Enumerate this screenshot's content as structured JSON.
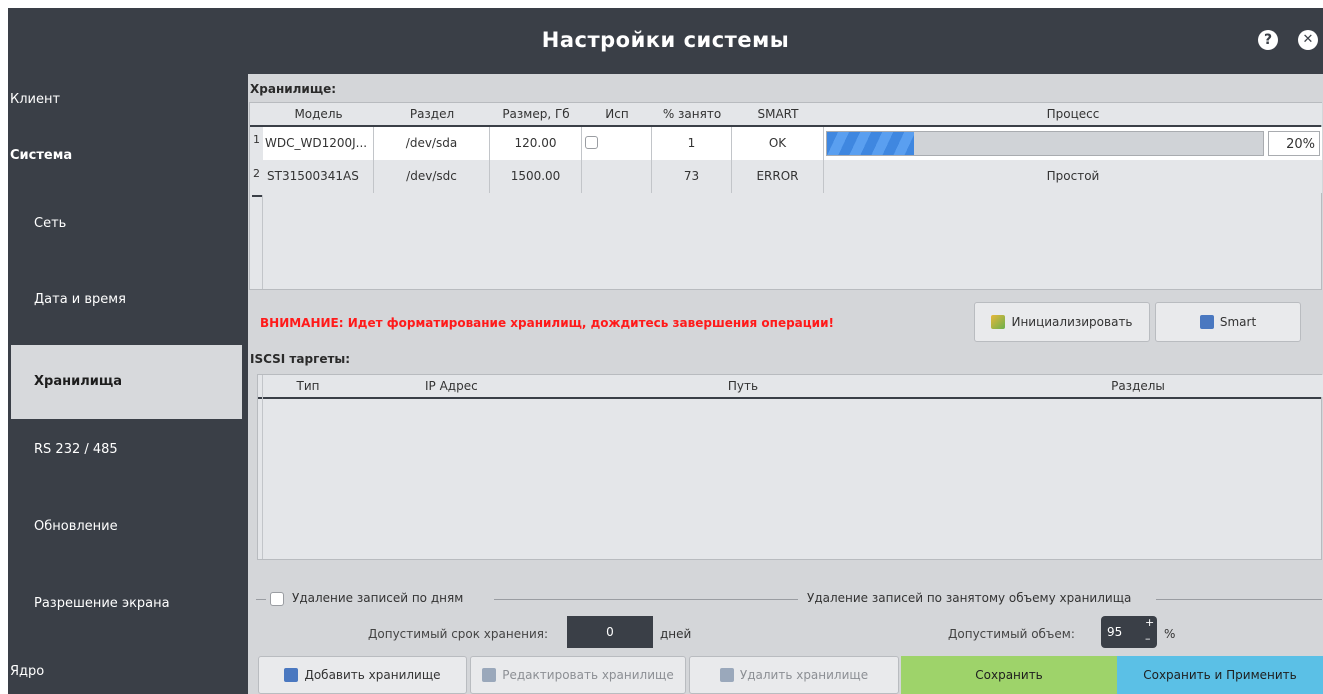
{
  "window": {
    "title": "Настройки системы"
  },
  "titlebar": {
    "help_icon": "?",
    "close_icon": "✕"
  },
  "sidebar": {
    "items": [
      {
        "label": "Клиент"
      },
      {
        "label": "Система"
      },
      {
        "label": "Сеть"
      },
      {
        "label": "Дата и время"
      },
      {
        "label": "Хранилища"
      },
      {
        "label": "RS 232 / 485"
      },
      {
        "label": "Обновление"
      },
      {
        "label": "Разрешение экрана"
      },
      {
        "label": "Ядро"
      }
    ]
  },
  "storage": {
    "label": "Хранилище:",
    "columns": [
      "Модель",
      "Раздел",
      "Размер, Гб",
      "Исп",
      "% занято",
      "SMART",
      "Процесс"
    ],
    "rows": [
      {
        "num": "1",
        "model": "WDC_WD1200J...",
        "partition": "/dev/sda",
        "size": "120.00",
        "used_checked": false,
        "percent": "1",
        "smart": "OK",
        "progress": 0.2,
        "progress_text": "20%"
      },
      {
        "num": "2",
        "model": "ST31500341AS",
        "partition": "/dev/sdc",
        "size": "1500.00",
        "percent": "73",
        "smart": "ERROR",
        "process": "Простой"
      }
    ]
  },
  "warning": "ВНИМАНИЕ: Идет форматирование хранилищ, дождитесь завершения операции!",
  "buttons": {
    "initialize": "Инициализировать",
    "smart": "Smart"
  },
  "iscsi": {
    "label": "ISCSI таргеты:",
    "columns": [
      "Тип",
      "IP Адрес",
      "Путь",
      "Разделы"
    ]
  },
  "retention": {
    "by_days_label": "Удаление записей по дням",
    "by_volume_label": "Удаление записей по занятому объему хранилища",
    "term_label": "Допустимый срок хранения:",
    "term_value": "0",
    "term_unit": "дней",
    "volume_label": "Допустимый объем:",
    "volume_value": "95",
    "volume_unit": "%"
  },
  "footer": {
    "add": "Добавить хранилище",
    "edit": "Редактировать хранилище",
    "delete": "Удалить хранилище",
    "save": "Сохранить",
    "save_apply": "Сохранить и Применить"
  },
  "colors": {
    "accent_green": "#9ed36a",
    "accent_blue": "#5bc0e6",
    "warning": "#ff1a1a",
    "progress": "#4d95e8"
  }
}
